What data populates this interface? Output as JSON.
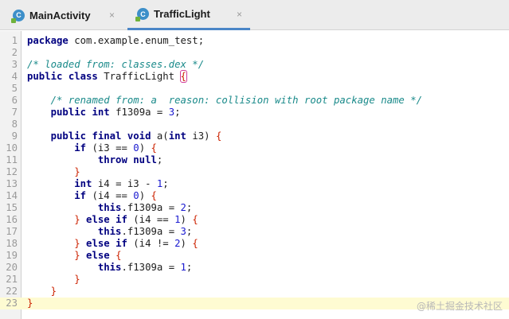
{
  "tabs": [
    {
      "label": "MainActivity",
      "active": false,
      "icon": "class-c-icon"
    },
    {
      "label": "TrafficLight",
      "active": true,
      "icon": "class-c-icon"
    }
  ],
  "tab_close_glyph": "×",
  "colors": {
    "keyword": "#000080",
    "comment": "#1a8a8a",
    "number": "#1a1ad0",
    "brace": "#cc2200",
    "highlight_line": "#fefbd2",
    "tab_underline": "#4a86c7"
  },
  "editor": {
    "highlighted_line": 23,
    "lines": [
      {
        "n": "1",
        "tokens": [
          [
            "kw",
            "package"
          ],
          [
            "t",
            " com.example.enum_test;"
          ]
        ]
      },
      {
        "n": "2",
        "tokens": []
      },
      {
        "n": "3",
        "tokens": [
          [
            "cm",
            "/* loaded from: classes.dex */"
          ]
        ]
      },
      {
        "n": "4",
        "tokens": [
          [
            "kw",
            "public class"
          ],
          [
            "t",
            " TrafficLight "
          ],
          [
            "bm",
            "{"
          ]
        ]
      },
      {
        "n": "5",
        "tokens": []
      },
      {
        "n": "6",
        "tokens": [
          [
            "t",
            "    "
          ],
          [
            "cm",
            "/* renamed from: a  reason: collision with root package name */"
          ]
        ]
      },
      {
        "n": "7",
        "tokens": [
          [
            "t",
            "    "
          ],
          [
            "kw",
            "public int"
          ],
          [
            "t",
            " f1309a = "
          ],
          [
            "num",
            "3"
          ],
          [
            "t",
            ";"
          ]
        ]
      },
      {
        "n": "8",
        "tokens": []
      },
      {
        "n": "9",
        "tokens": [
          [
            "t",
            "    "
          ],
          [
            "kw",
            "public final void"
          ],
          [
            "t",
            " a("
          ],
          [
            "kw",
            "int"
          ],
          [
            "t",
            " i3) "
          ],
          [
            "br",
            "{"
          ]
        ]
      },
      {
        "n": "10",
        "tokens": [
          [
            "t",
            "        "
          ],
          [
            "kw",
            "if"
          ],
          [
            "t",
            " (i3 == "
          ],
          [
            "num",
            "0"
          ],
          [
            "t",
            ") "
          ],
          [
            "br",
            "{"
          ]
        ]
      },
      {
        "n": "11",
        "tokens": [
          [
            "t",
            "            "
          ],
          [
            "kw",
            "throw null"
          ],
          [
            "t",
            ";"
          ]
        ]
      },
      {
        "n": "12",
        "tokens": [
          [
            "t",
            "        "
          ],
          [
            "br",
            "}"
          ]
        ]
      },
      {
        "n": "13",
        "tokens": [
          [
            "t",
            "        "
          ],
          [
            "kw",
            "int"
          ],
          [
            "t",
            " i4 = i3 - "
          ],
          [
            "num",
            "1"
          ],
          [
            "t",
            ";"
          ]
        ]
      },
      {
        "n": "14",
        "tokens": [
          [
            "t",
            "        "
          ],
          [
            "kw",
            "if"
          ],
          [
            "t",
            " (i4 == "
          ],
          [
            "num",
            "0"
          ],
          [
            "t",
            ") "
          ],
          [
            "br",
            "{"
          ]
        ]
      },
      {
        "n": "15",
        "tokens": [
          [
            "t",
            "            "
          ],
          [
            "kw",
            "this"
          ],
          [
            "t",
            ".f1309a = "
          ],
          [
            "num",
            "2"
          ],
          [
            "t",
            ";"
          ]
        ]
      },
      {
        "n": "16",
        "tokens": [
          [
            "t",
            "        "
          ],
          [
            "br",
            "}"
          ],
          [
            "t",
            " "
          ],
          [
            "kw",
            "else if"
          ],
          [
            "t",
            " (i4 == "
          ],
          [
            "num",
            "1"
          ],
          [
            "t",
            ") "
          ],
          [
            "br",
            "{"
          ]
        ]
      },
      {
        "n": "17",
        "tokens": [
          [
            "t",
            "            "
          ],
          [
            "kw",
            "this"
          ],
          [
            "t",
            ".f1309a = "
          ],
          [
            "num",
            "3"
          ],
          [
            "t",
            ";"
          ]
        ]
      },
      {
        "n": "18",
        "tokens": [
          [
            "t",
            "        "
          ],
          [
            "br",
            "}"
          ],
          [
            "t",
            " "
          ],
          [
            "kw",
            "else if"
          ],
          [
            "t",
            " (i4 != "
          ],
          [
            "num",
            "2"
          ],
          [
            "t",
            ") "
          ],
          [
            "br",
            "{"
          ]
        ]
      },
      {
        "n": "19",
        "tokens": [
          [
            "t",
            "        "
          ],
          [
            "br",
            "}"
          ],
          [
            "t",
            " "
          ],
          [
            "kw",
            "else"
          ],
          [
            "t",
            " "
          ],
          [
            "br",
            "{"
          ]
        ]
      },
      {
        "n": "20",
        "tokens": [
          [
            "t",
            "            "
          ],
          [
            "kw",
            "this"
          ],
          [
            "t",
            ".f1309a = "
          ],
          [
            "num",
            "1"
          ],
          [
            "t",
            ";"
          ]
        ]
      },
      {
        "n": "21",
        "tokens": [
          [
            "t",
            "        "
          ],
          [
            "br",
            "}"
          ]
        ]
      },
      {
        "n": "22",
        "tokens": [
          [
            "t",
            "    "
          ],
          [
            "br",
            "}"
          ]
        ]
      },
      {
        "n": "23",
        "tokens": [
          [
            "br",
            "}"
          ]
        ]
      }
    ]
  },
  "watermark": "@稀土掘金技术社区"
}
